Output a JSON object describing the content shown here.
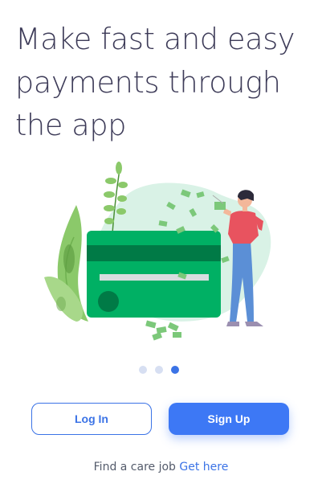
{
  "onboarding": {
    "headline_lines": [
      "Make fast and easy",
      "payments through",
      "the app"
    ],
    "illustration_icon": "payment-card-illustration",
    "pagination": {
      "total": 3,
      "active_index": 2
    }
  },
  "actions": {
    "login_label": "Log In",
    "signup_label": "Sign Up"
  },
  "footer": {
    "prompt_text": "Find a care job",
    "link_text": "Get here"
  },
  "colors": {
    "primary": "#3d78f5",
    "headline": "#3d3b58",
    "card_green": "#00b064",
    "leaf_green": "#8bc96a"
  }
}
